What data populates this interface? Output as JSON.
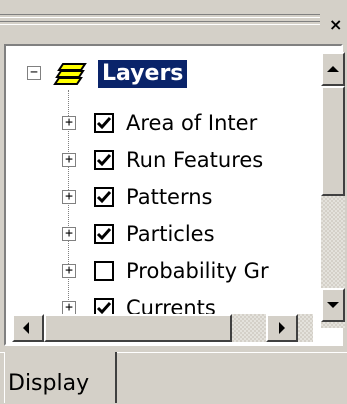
{
  "panel": {
    "root": {
      "label": "Layers",
      "expander": "−",
      "icon": "layers-stack-icon"
    },
    "layers": [
      {
        "label": "Area of Inter",
        "checked": true,
        "expander": "+"
      },
      {
        "label": "Run Features",
        "checked": true,
        "expander": "+"
      },
      {
        "label": "Patterns",
        "checked": true,
        "expander": "+"
      },
      {
        "label": "Particles",
        "checked": true,
        "expander": "+"
      },
      {
        "label": "Probability Gr",
        "checked": false,
        "expander": "+"
      },
      {
        "label": "Currents",
        "checked": true,
        "expander": "+"
      }
    ]
  },
  "tabs": [
    {
      "label": "Display",
      "selected": true
    }
  ],
  "colors": {
    "face": "#d4d0c8",
    "selection": "#0a246a",
    "layers_icon_fill": "#ffff00"
  }
}
